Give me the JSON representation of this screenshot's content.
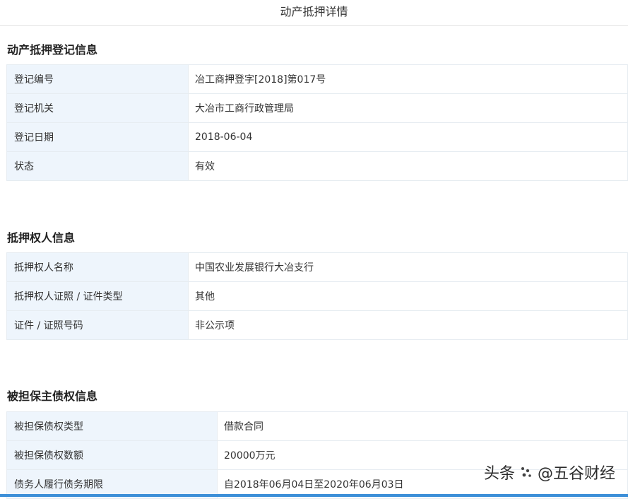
{
  "page_title": "动产抵押详情",
  "sections": [
    {
      "title": "动产抵押登记信息",
      "rows": [
        {
          "label": "登记编号",
          "value": "冶工商押登字[2018]第017号"
        },
        {
          "label": "登记机关",
          "value": "大冶市工商行政管理局"
        },
        {
          "label": "登记日期",
          "value": "2018-06-04"
        },
        {
          "label": "状态",
          "value": "有效"
        }
      ]
    },
    {
      "title": "抵押权人信息",
      "rows": [
        {
          "label": "抵押权人名称",
          "value": "中国农业发展银行大冶支行"
        },
        {
          "label": "抵押权人证照 / 证件类型",
          "value": "其他"
        },
        {
          "label": "证件 / 证照号码",
          "value": "非公示项"
        }
      ]
    },
    {
      "title": "被担保主债权信息",
      "rows": [
        {
          "label": "被担保债权类型",
          "value": "借款合同"
        },
        {
          "label": "被担保债权数额",
          "value": "20000万元"
        },
        {
          "label": "债务人履行债务期限",
          "value": "自2018年06月04日至2020年06月03日"
        }
      ]
    }
  ],
  "watermark": {
    "prefix": "头条",
    "handle": "@五谷财经"
  },
  "colors": {
    "label_bg": "#eef5fc",
    "border": "#e6ecf1",
    "accent_bar": "#3c8fd8"
  }
}
